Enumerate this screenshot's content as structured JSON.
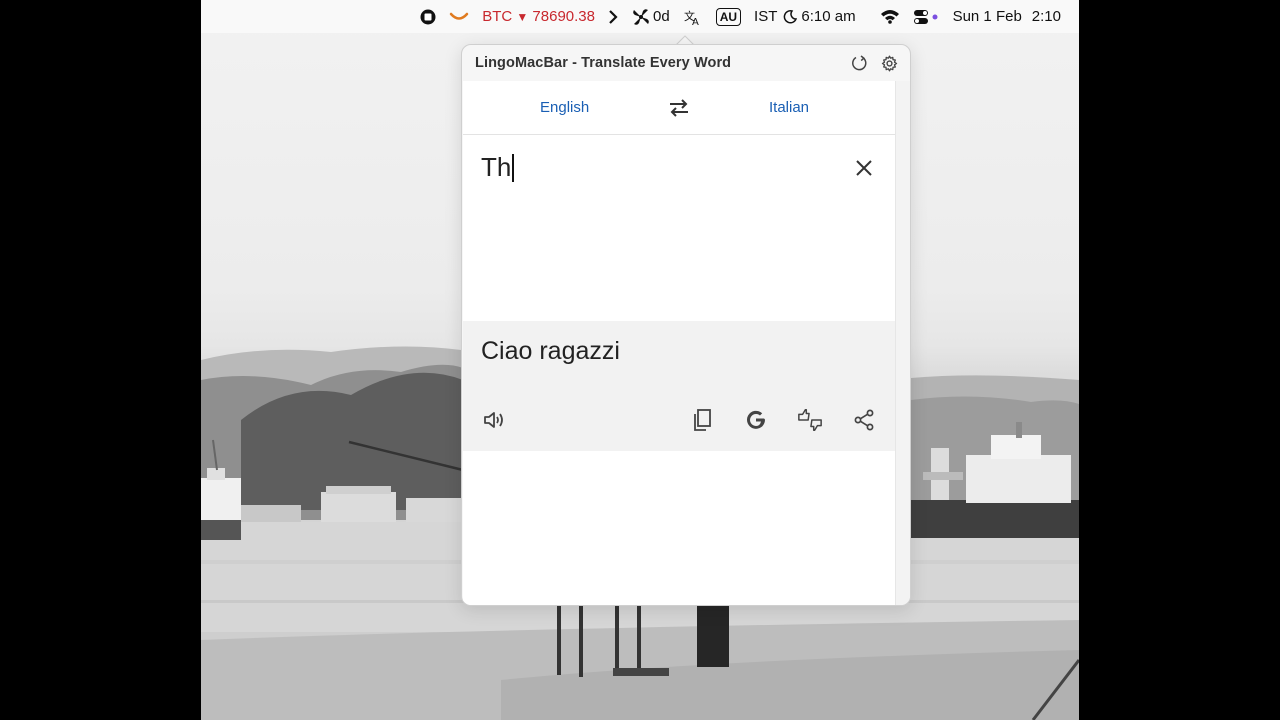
{
  "menubar": {
    "btc_label": "BTC",
    "btc_arrow": "▼",
    "btc_value": "78690.38",
    "timer": "0d",
    "keyboard_layout": "AU",
    "timezone": "IST",
    "tz_time": "6:10 am",
    "date": "Sun 1 Feb",
    "time": "2:10"
  },
  "popover": {
    "title": "LingoMacBar - Translate Every Word",
    "source_language": "English",
    "target_language": "Italian",
    "input_text": "Th",
    "translation": "Ciao ragazzi"
  },
  "icons": {
    "record": "record-icon",
    "app_status": "smile-icon",
    "chevron": "chevron-right-icon",
    "fan": "fan-icon",
    "translate": "translate-icon",
    "moon": "moon-icon",
    "wifi": "wifi-icon",
    "control_center": "control-center-icon",
    "refresh": "refresh-icon",
    "settings": "gear-icon",
    "swap": "swap-icon",
    "clear": "close-icon",
    "speak": "speaker-icon",
    "copy": "copy-icon",
    "google": "google-icon",
    "feedback": "thumbs-feedback-icon",
    "share": "share-icon"
  },
  "colors": {
    "accent": "#1a5fb4",
    "btc": "#c8282e",
    "result_bg": "#f2f2f2"
  }
}
